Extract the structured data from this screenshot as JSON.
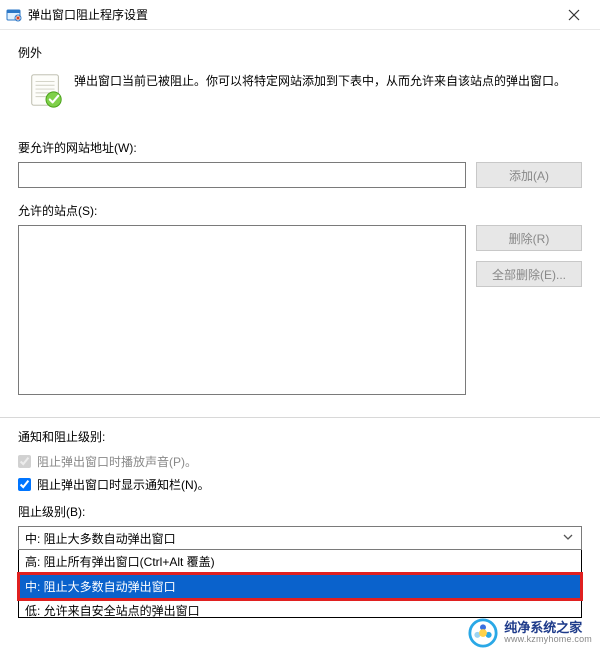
{
  "title": "弹出窗口阻止程序设置",
  "exceptions": {
    "heading": "例外",
    "info_text": "弹出窗口当前已被阻止。你可以将特定网站添加到下表中，从而允许来自该站点的弹出窗口。",
    "address_label": "要允许的网站地址(W):",
    "address_value": "",
    "allowed_sites_label": "允许的站点(S):",
    "btn_add": "添加(A)",
    "btn_remove": "删除(R)",
    "btn_remove_all": "全部删除(E)..."
  },
  "notifications": {
    "heading": "通知和阻止级别:",
    "chk_play_sound_label": "阻止弹出窗口时播放声音(P)。",
    "chk_play_sound_checked": true,
    "chk_show_bar_label": "阻止弹出窗口时显示通知栏(N)。",
    "chk_show_bar_checked": true,
    "blocking_level_label": "阻止级别(B):",
    "combo_selected": "中: 阻止大多数自动弹出窗口",
    "dropdown_items": [
      "高: 阻止所有弹出窗口(Ctrl+Alt 覆盖)",
      "中: 阻止大多数自动弹出窗口",
      "低: 允许来自安全站点的弹出窗口"
    ],
    "dropdown_selected_index": 1
  },
  "watermark": {
    "brand_cn": "纯净系统之家",
    "url": "www.kzmyhome.com"
  }
}
